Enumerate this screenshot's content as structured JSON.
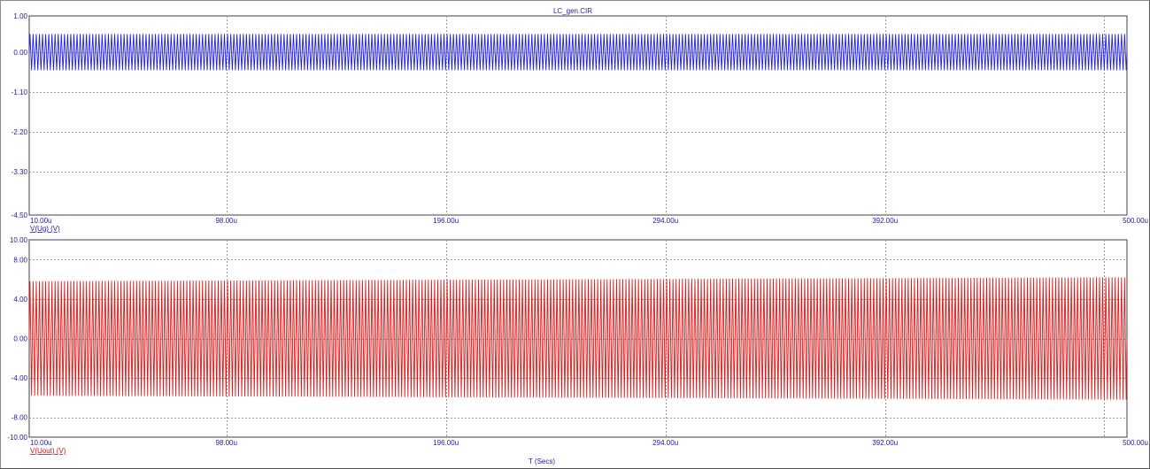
{
  "window": {
    "title": "LC_gen.CIR",
    "x_axis_title": "T (Secs)"
  },
  "colors": {
    "top_trace": "#1f1fe0",
    "bottom_trace": "#e01818",
    "label_blue": "#1a1aa0",
    "label_red": "#d01010",
    "grid": "#9a9a9a",
    "plot_border": "#404040"
  },
  "chart_data": [
    {
      "type": "line",
      "series": [
        {
          "name": "V(Ug) (V)",
          "amplitude": 0.5,
          "offset": 0.0
        }
      ],
      "x_unit": "s",
      "xlim": [
        1e-05,
        0.0005
      ],
      "x_tick_labels": [
        "10.00u",
        "98.00u",
        "196.00u",
        "294.00u",
        "392.00u",
        "500.00u"
      ],
      "x_ticks": [
        1e-05,
        9.8e-05,
        0.000196,
        0.000294,
        0.000392,
        0.0005
      ],
      "ylim": [
        -4.5,
        1.0
      ],
      "y_ticks": [
        1.0,
        0.0,
        -1.1,
        -2.2,
        -3.3,
        -4.5
      ],
      "y_tick_labels": [
        "1.00",
        "0.00",
        "-1.10",
        "-2.20",
        "-3.30",
        "-4.50"
      ],
      "approx_cycles": 350,
      "grid": true
    },
    {
      "type": "line",
      "series": [
        {
          "name": "V(Uout) (V)",
          "amplitude_start": 5.8,
          "amplitude_end": 6.2,
          "offset": 0.0
        }
      ],
      "x_unit": "s",
      "xlim": [
        1e-05,
        0.0005
      ],
      "x_tick_labels": [
        "10.00u",
        "98.00u",
        "196.00u",
        "294.00u",
        "392.00u",
        "500.00u"
      ],
      "x_ticks": [
        1e-05,
        9.8e-05,
        0.000196,
        0.000294,
        0.000392,
        0.0005
      ],
      "ylim": [
        -10.0,
        10.0
      ],
      "y_ticks": [
        10.0,
        8.0,
        4.0,
        0.0,
        -4.0,
        -8.0,
        -10.0
      ],
      "y_tick_labels": [
        "10.00",
        "8.00",
        "4.00",
        "0.00",
        "-4.00",
        "-8.00",
        "-10.00"
      ],
      "approx_cycles": 350,
      "grid": true
    }
  ]
}
